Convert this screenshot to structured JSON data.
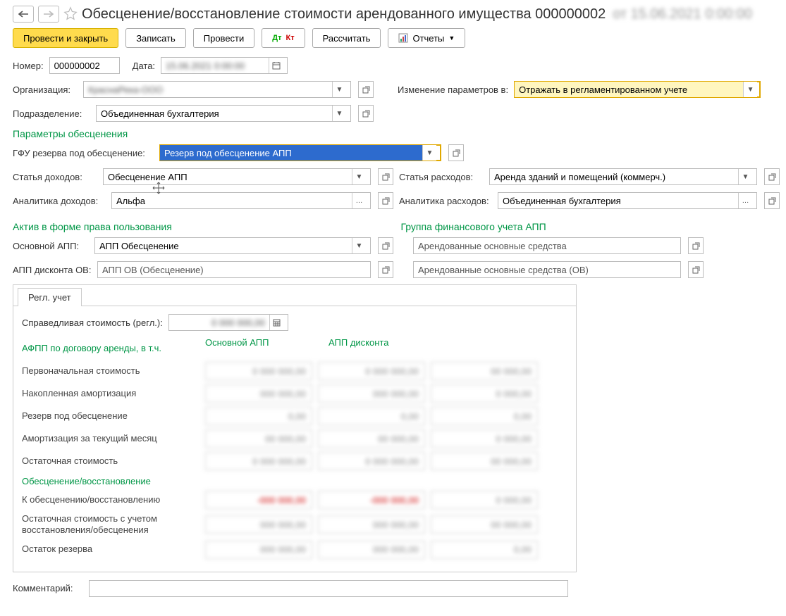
{
  "header": {
    "title": "Обесценение/восстановление стоимости арендованного имущества 000000002",
    "title_blur": "от 15.06.2021 0:00:00"
  },
  "toolbar": {
    "post_close": "Провести и закрыть",
    "save": "Записать",
    "post": "Провести",
    "dtkt_icon": "Дт Кт",
    "calc": "Рассчитать",
    "reports": "Отчеты"
  },
  "fields": {
    "number_label": "Номер:",
    "number_value": "000000002",
    "date_label": "Дата:",
    "date_value": "15.06.2021 0:00:00",
    "org_label": "Организация:",
    "org_value": "КраснаРека-ООО",
    "dept_label": "Подразделение:",
    "dept_value": "Объединенная бухгалтерия",
    "change_params_label": "Изменение параметров в:",
    "change_params_value": "Отражать в регламентированном учете"
  },
  "sections": {
    "params_title": "Параметры обесценения",
    "gfu_label": "ГФУ резерва под обесценение:",
    "gfu_value": "Резерв под обесценение АПП",
    "income_article_label": "Статья доходов:",
    "income_article_value": "Обесценение АПП",
    "expense_article_label": "Статья расходов:",
    "expense_article_value": "Аренда зданий и помещений (коммерч.)",
    "income_analytics_label": "Аналитика доходов:",
    "income_analytics_value": "Альфа",
    "expense_analytics_label": "Аналитика расходов:",
    "expense_analytics_value": "Объединенная бухгалтерия",
    "asset_title": "Актив в форме права пользования",
    "group_title": "Группа финансового учета АПП",
    "main_app_label": "Основной АПП:",
    "main_app_value": "АПП Обесценение",
    "main_app_group_value": "Арендованные основные средства",
    "discount_app_label": "АПП дисконта ОВ:",
    "discount_app_value": "АПП ОВ (Обесценение)",
    "discount_app_group_value": "Арендованные основные средства (ОВ)"
  },
  "tab": {
    "label": "Регл. учет",
    "fair_value_label": "Справедливая стоимость (регл.):",
    "fair_value": "0 000 000,00",
    "head_col1": "АФПП по договору аренды, в т.ч.",
    "head_col2": "Основной АПП",
    "head_col3": "АПП дисконта",
    "rows": [
      {
        "label": "Первоначальная стоимость",
        "c1": "0 000 000,00",
        "c2": "0 000 000,00",
        "c3": "00 000,00"
      },
      {
        "label": "Накопленная амортизация",
        "c1": "000 000,00",
        "c2": "000 000,00",
        "c3": "0 000,00"
      },
      {
        "label": "Резерв под обесценение",
        "c1": "0,00",
        "c2": "0,00",
        "c3": "0,00"
      },
      {
        "label": "Амортизация за текущий месяц",
        "c1": "00 000,00",
        "c2": "00 000,00",
        "c3": "0 000,00"
      },
      {
        "label": "Остаточная стоимость",
        "c1": "0 000 000,00",
        "c2": "0 000 000,00",
        "c3": "00 000,00"
      }
    ],
    "section2_title": "Обесценение/восстановление",
    "rows2": [
      {
        "label": "К обесценению/восстановлению",
        "c1": "-000 000,00",
        "c2": "-000 000,00",
        "c3": "0 000,00",
        "red": true,
        "red3": false
      },
      {
        "label": "Остаточная стоимость с учетом восстановления/обесценения",
        "c1": "000 000,00",
        "c2": "000 000,00",
        "c3": "00 000,00"
      },
      {
        "label": "Остаток резерва",
        "c1": "000 000,00",
        "c2": "000 000,00",
        "c3": "0,00"
      }
    ]
  },
  "comment_label": "Комментарий:",
  "comment_value": ""
}
